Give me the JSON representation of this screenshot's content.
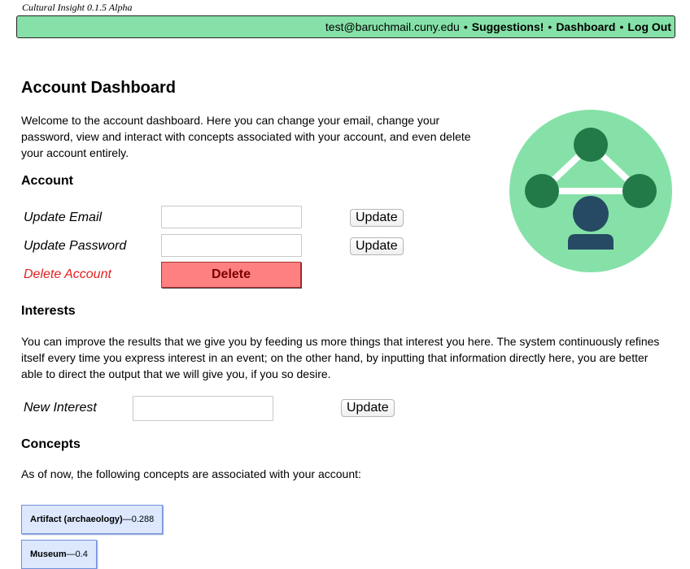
{
  "app": {
    "title": "Cultural Insight 0.1.5 Alpha"
  },
  "topbar": {
    "email": "test@baruchmail.cuny.edu",
    "separator": "•",
    "suggestions": "Suggestions!",
    "dashboard": "Dashboard",
    "logout": "Log Out",
    "color": "#86e1a8"
  },
  "page": {
    "title": "Account Dashboard",
    "intro": "Welcome to the account dashboard. Here you can change your email, change your password, view and interact with concepts associated with your account, and even delete your account entirely."
  },
  "account": {
    "heading": "Account",
    "update_email_label": "Update Email",
    "update_password_label": "Update Password",
    "delete_account_label": "Delete Account",
    "update_button": "Update",
    "delete_button": "Delete",
    "email_value": "",
    "password_value": "",
    "delete_color": "#ff8080"
  },
  "interests": {
    "heading": "Interests",
    "description": "You can improve the results that we give you by feeding us more things that interest you here. The system continuously refines itself every time you express interest in an event; on the other hand, by inputting that information directly here, you are better able to direct the output that we will give you, if you so desire.",
    "new_interest_label": "New Interest",
    "new_interest_value": "",
    "update_button": "Update"
  },
  "concepts": {
    "heading": "Concepts",
    "description": "As of now, the following concepts are associated with your account:",
    "items": [
      {
        "name": "Artifact (archaeology)",
        "dash": "—",
        "score": "0.288"
      },
      {
        "name": "Museum",
        "dash": "—",
        "score": "0.4"
      }
    ]
  },
  "illustration": {
    "icon": "network-user-icon",
    "circle_color": "#86e1a8",
    "node_color": "#217a47",
    "user_color": "#264a63"
  }
}
